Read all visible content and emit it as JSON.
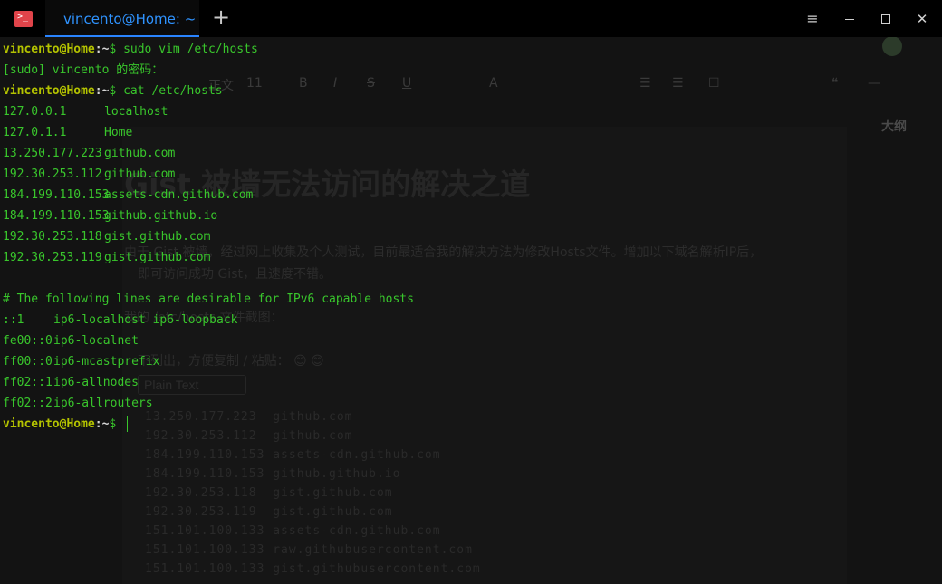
{
  "window": {
    "tab_title": "vincento@Home: ~",
    "new_tab_symbol": "+",
    "menu_symbol": "≡",
    "close_symbol": "✕"
  },
  "background_editor": {
    "header_fragment": "被墙无法访问的解决方",
    "toolbar": {
      "font_label": "正文",
      "font_size": "11"
    },
    "outline_label": "大纲",
    "article_title": "Gist 被墙无法访问的解决之道",
    "para_1": "由于 Gist 被墙，经过网上收集及个人测试，目前最适合我的解决方法为修改Hosts文件。增加以下域名解析IP后，",
    "para_2": "即可访问成功 Gist，且速度不错。",
    "para_3": "我的 /etc/hosts 文件截图：",
    "para_4": "下列出，方便复制 / 粘贴： 😊 😊",
    "code_lang": "Plain Text",
    "code_lines": [
      "13.250.177.223  github.com",
      "192.30.253.112  github.com",
      "184.199.110.153 assets-cdn.github.com",
      "184.199.110.153 github.github.io",
      "192.30.253.118  gist.github.com",
      "192.30.253.119  gist.github.com",
      "151.101.100.133 assets-cdn.github.com",
      "151.101.100.133 raw.githubusercontent.com",
      "151.101.100.133 gist.githubusercontent.com"
    ]
  },
  "terminal": {
    "prompt_user": "vincento@Home",
    "prompt_path": ":~",
    "prompt_symbol": "$ ",
    "cmd_1": "sudo vim /etc/hosts",
    "sudo_prompt": "[sudo] vincento 的密码：",
    "cmd_2": "cat /etc/hosts",
    "hosts": [
      {
        "ip": "127.0.0.1",
        "host": "localhost"
      },
      {
        "ip": "127.0.1.1",
        "host": "Home"
      },
      {
        "ip": "13.250.177.223",
        "host": "github.com"
      },
      {
        "ip": "192.30.253.112",
        "host": "github.com"
      },
      {
        "ip": "184.199.110.153",
        "host": "assets-cdn.github.com"
      },
      {
        "ip": "184.199.110.153",
        "host": "github.github.io"
      },
      {
        "ip": "192.30.253.118",
        "host": "gist.github.com"
      },
      {
        "ip": "192.30.253.119",
        "host": "gist.github.com"
      }
    ],
    "comment": "# The following lines are desirable for IPv6 capable hosts",
    "ipv6_hosts": [
      {
        "ip": "::1",
        "host": "ip6-localhost ip6-loopback"
      },
      {
        "ip": "fe00::0",
        "host": "ip6-localnet"
      },
      {
        "ip": "ff00::0",
        "host": "ip6-mcastprefix"
      },
      {
        "ip": "ff02::1",
        "host": "ip6-allnodes"
      },
      {
        "ip": "ff02::2",
        "host": "ip6-allrouters"
      }
    ]
  },
  "colors": {
    "terminal_text": "#39c62c",
    "prompt_user": "#b4c300",
    "tab_accent": "#2a84ff",
    "app_icon": "#e0444a"
  }
}
